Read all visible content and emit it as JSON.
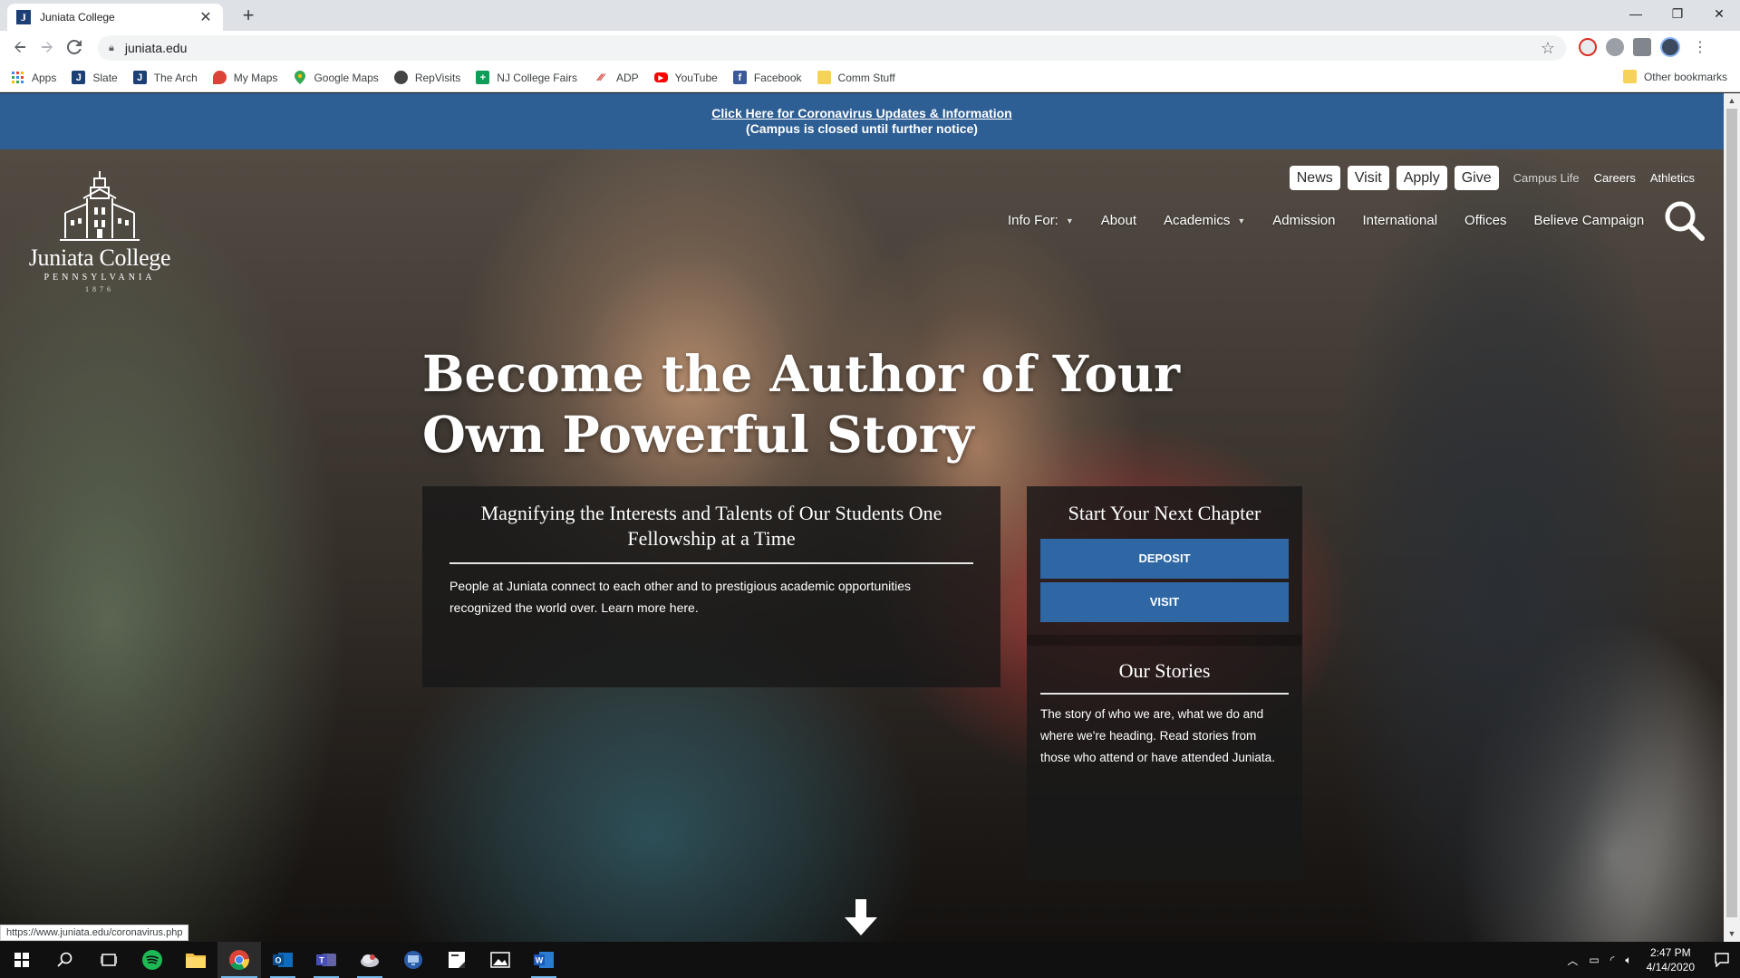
{
  "browser": {
    "tab_title": "Juniata College",
    "new_tab": "+",
    "url": "juniata.edu",
    "bookmarks": [
      {
        "label": "Apps",
        "icon": "apps-grid-icon",
        "color": "#4285f4"
      },
      {
        "label": "Slate",
        "icon": "slate-icon",
        "color": "#1c3f75"
      },
      {
        "label": "The Arch",
        "icon": "juniata-icon",
        "color": "#1c3f75"
      },
      {
        "label": "My Maps",
        "icon": "my-maps-icon",
        "color": "#db4437"
      },
      {
        "label": "Google Maps",
        "icon": "google-maps-icon",
        "color": "#34a853"
      },
      {
        "label": "RepVisits",
        "icon": "repvisits-icon",
        "color": "#444444"
      },
      {
        "label": "NJ College Fairs",
        "icon": "nj-fairs-icon",
        "color": "#0f9d58"
      },
      {
        "label": "ADP",
        "icon": "adp-icon",
        "color": "#d0271d"
      },
      {
        "label": "YouTube",
        "icon": "youtube-icon",
        "color": "#ff0000"
      },
      {
        "label": "Facebook",
        "icon": "facebook-icon",
        "color": "#3b5998"
      },
      {
        "label": "Comm Stuff",
        "icon": "folder-icon",
        "color": "#f6d356"
      }
    ],
    "other_bookmarks": "Other bookmarks",
    "status_url": "https://www.juniata.edu/coronavirus.php"
  },
  "site": {
    "alert": {
      "link": "Click Here for Coronavirus Updates & Information",
      "sub": "(Campus is closed until further notice)"
    },
    "logo": {
      "name": "Juniata College",
      "state": "PENNSYLVANIA",
      "year": "1876"
    },
    "util_nav": {
      "news": "News",
      "visit": "Visit",
      "apply": "Apply",
      "give": "Give",
      "campus_life": "Campus Life",
      "careers": "Careers",
      "athletics": "Athletics"
    },
    "main_nav": {
      "info_for": "Info For:",
      "about": "About",
      "academics": "Academics",
      "admission": "Admission",
      "international": "International",
      "offices": "Offices",
      "believe": "Believe Campaign"
    },
    "headline": "Become the Author of Your Own Powerful Story",
    "feature": {
      "title": "Magnifying the Interests and Talents of Our Students One Fellowship at a Time",
      "text": "People at Juniata connect to each other and to prestigious academic opportunities recognized the world over. Learn more here."
    },
    "sidebar": {
      "title": "Start Your Next Chapter",
      "deposit": "DEPOSIT",
      "visit": "VISIT",
      "stories_title": "Our Stories",
      "stories_text": "The story of who we are, what we do and where we're heading. Read stories from those who attend or have attended Juniata."
    }
  },
  "taskbar": {
    "time": "2:47 PM",
    "date": "4/14/2020"
  },
  "colors": {
    "alert_bar": "#2e5f94",
    "cta": "#2f66a4"
  }
}
